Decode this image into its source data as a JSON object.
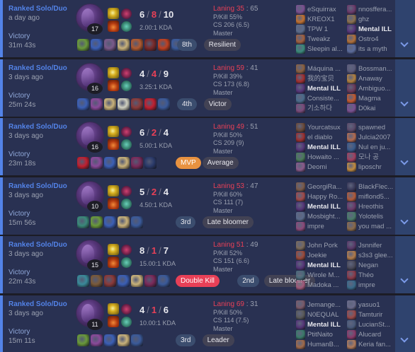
{
  "colors": {
    "background": "#1c1c25",
    "card": "#293152",
    "win_accent": "#5383e8",
    "expand_bg": "#2f436e",
    "death_red": "#e84057",
    "mvp_orange": "#e89240",
    "tag_gray": "#424254"
  },
  "matches": [
    {
      "queue": "Ranked Solo/Duo",
      "ago": "a day ago",
      "result": "Victory",
      "duration": "31m 43s",
      "champ_level": "17",
      "kills": "6",
      "deaths": "8",
      "assists": "10",
      "kda_ratio": "2.00:1 KDA",
      "laning_label": "Laning",
      "laning_win": "35",
      "laning_loss": "65",
      "pkill": "P/Kill 55%",
      "cs": "CS 206 (6.5)",
      "rank": "Master",
      "item_colors": [
        "#6a9a3a",
        "#3b5fb5",
        "#7a5a8a",
        "#c9b27a",
        "#b05a30",
        "#7a2a2a",
        "#c04020",
        "#3a5a9a"
      ],
      "tags": [
        {
          "label": "8th",
          "style": "pos"
        },
        {
          "label": "Resilient",
          "style": "norm"
        }
      ],
      "blue_team": [
        {
          "name": "eSquirrax",
          "color": "#7a5090"
        },
        {
          "name": "KREOX1",
          "color": "#c07030"
        },
        {
          "name": "TPW 1",
          "color": "#5a6a8a"
        },
        {
          "name": "Tweakz",
          "color": "#a06040"
        },
        {
          "name": "Sleepin al...",
          "color": "#3a8a7a"
        }
      ],
      "red_team": [
        {
          "name": "nnosffera...",
          "color": "#6a3a6a"
        },
        {
          "name": "ghz",
          "color": "#8a7050"
        },
        {
          "name": "Mental ILL",
          "color": "#553578",
          "me": true
        },
        {
          "name": "Ostro4",
          "color": "#b0703a"
        },
        {
          "name": "its a myth",
          "color": "#5a6a9a"
        }
      ]
    },
    {
      "queue": "Ranked Solo/Duo",
      "ago": "3 days ago",
      "result": "Victory",
      "duration": "25m 24s",
      "champ_level": "16",
      "kills": "4",
      "deaths": "4",
      "assists": "9",
      "kda_ratio": "3.25:1 KDA",
      "laning_label": "Laning",
      "laning_win": "59",
      "laning_loss": "41",
      "pkill": "P/Kill 39%",
      "cs": "CS 173 (6.8)",
      "rank": "Master",
      "item_colors": [
        "#3b5fb5",
        "#8a4a9a",
        "#c9b27a",
        "#d0d0c0",
        "#8a3a3a",
        "#c02030",
        "#3a5a9a"
      ],
      "tags": [
        {
          "label": "4th",
          "style": "pos"
        },
        {
          "label": "Victor",
          "style": "norm"
        }
      ],
      "blue_team": [
        {
          "name": "Máquina ...",
          "color": "#8a6040"
        },
        {
          "name": "我的宝贝",
          "color": "#a03030"
        },
        {
          "name": "Mental ILL",
          "color": "#553578",
          "me": true
        },
        {
          "name": "Consiste...",
          "color": "#4a6a8a"
        },
        {
          "name": "기소하다",
          "color": "#7a4a7a"
        }
      ],
      "red_team": [
        {
          "name": "Bossman...",
          "color": "#5a5a7a"
        },
        {
          "name": "Anaway",
          "color": "#b08040"
        },
        {
          "name": "Ambiguo...",
          "color": "#6a3a5a"
        },
        {
          "name": "Magma",
          "color": "#c05a30"
        },
        {
          "name": "D0kai",
          "color": "#7a5090"
        }
      ]
    },
    {
      "queue": "Ranked Solo/Duo",
      "ago": "3 days ago",
      "result": "Victory",
      "duration": "23m 18s",
      "champ_level": "16",
      "kills": "6",
      "deaths": "2",
      "assists": "4",
      "kda_ratio": "5.00:1 KDA",
      "laning_label": "Laning",
      "laning_win": "49",
      "laning_loss": "51",
      "pkill": "P/Kill 50%",
      "cs": "CS 209 (9)",
      "rank": "Master",
      "item_colors": [
        "#c02030",
        "#8a4a9a",
        "#3b5fb5",
        "#c9b27a",
        "#7a2a5a",
        "#2a3a6a"
      ],
      "tags": [
        {
          "label": "MVP",
          "style": "mvp"
        },
        {
          "label": "Average",
          "style": "norm"
        }
      ],
      "blue_team": [
        {
          "name": "Yourcatsux",
          "color": "#6a4a3a"
        },
        {
          "name": "el diablo",
          "color": "#9a3030"
        },
        {
          "name": "Mental ILL",
          "color": "#553578",
          "me": true
        },
        {
          "name": "Howaito ...",
          "color": "#4a7a5a"
        },
        {
          "name": "Deomi",
          "color": "#8a5a8a"
        }
      ],
      "red_team": [
        {
          "name": "spawned",
          "color": "#5a4a6a"
        },
        {
          "name": "Julcia2007",
          "color": "#b06a50"
        },
        {
          "name": "Nul en ju...",
          "color": "#3a5a8a"
        },
        {
          "name": "모나 공",
          "color": "#a04060"
        },
        {
          "name": "liposchr",
          "color": "#c08a40"
        }
      ]
    },
    {
      "queue": "Ranked Solo/Duo",
      "ago": "3 days ago",
      "result": "Victory",
      "duration": "15m 56s",
      "champ_level": "10",
      "kills": "5",
      "deaths": "2",
      "assists": "4",
      "kda_ratio": "4.50:1 KDA",
      "laning_label": "Laning",
      "laning_win": "53",
      "laning_loss": "47",
      "pkill": "P/Kill 60%",
      "cs": "CS 111 (7)",
      "rank": "Master",
      "item_colors": [
        "#3a8a7a",
        "#6a9a3a",
        "#3b5fb5",
        "#c9b27a",
        "#3a5a9a"
      ],
      "tags": [
        {
          "label": "3rd",
          "style": "pos"
        },
        {
          "label": "Late bloomer",
          "style": "norm"
        }
      ],
      "blue_team": [
        {
          "name": "GeorgiRa...",
          "color": "#7a5a4a"
        },
        {
          "name": "Happy Ro...",
          "color": "#a04a4a"
        },
        {
          "name": "Mental ILL",
          "color": "#553578",
          "me": true
        },
        {
          "name": "Mosbight...",
          "color": "#5a6a8a"
        },
        {
          "name": "impre",
          "color": "#8a4a7a"
        }
      ],
      "red_team": [
        {
          "name": "BlackFlec...",
          "color": "#3a3a5a"
        },
        {
          "name": "miflond5...",
          "color": "#b05a3a"
        },
        {
          "name": "Hreothis",
          "color": "#6a3a6a"
        },
        {
          "name": "Yolotelis",
          "color": "#4a7a6a"
        },
        {
          "name": "you mad ...",
          "color": "#8a6a4a"
        }
      ]
    },
    {
      "queue": "Ranked Solo/Duo",
      "ago": "3 days ago",
      "result": "Victory",
      "duration": "22m 43s",
      "champ_level": "15",
      "kills": "8",
      "deaths": "1",
      "assists": "7",
      "kda_ratio": "15.00:1 KDA",
      "laning_label": "Laning",
      "laning_win": "51",
      "laning_loss": "49",
      "pkill": "P/Kill 52%",
      "cs": "CS 151 (6.6)",
      "rank": "Master",
      "item_colors": [
        "#3a8a9a",
        "#7a5a3a",
        "#8a3a3a",
        "#3b5fb5",
        "#c9b27a",
        "#7a2a5a",
        "#3a5a9a"
      ],
      "tags": [
        {
          "label": "Double Kill",
          "style": "red"
        },
        {
          "label": "2nd",
          "style": "pos"
        },
        {
          "label": "Late bloomer",
          "style": "norm"
        }
      ],
      "blue_team": [
        {
          "name": "John Pork",
          "color": "#7a6a5a"
        },
        {
          "name": "Joekie",
          "color": "#9a4a3a"
        },
        {
          "name": "Mental ILL",
          "color": "#553578",
          "me": true
        },
        {
          "name": "Wirole M...",
          "color": "#4a6a7a"
        },
        {
          "name": "Madoka ...",
          "color": "#a05a7a"
        }
      ],
      "red_team": [
        {
          "name": "Jsnnifer",
          "color": "#5a3a6a"
        },
        {
          "name": "s3s3 glee...",
          "color": "#b07a4a"
        },
        {
          "name": "Negan",
          "color": "#4a4a5a"
        },
        {
          "name": "Théo",
          "color": "#8a3a4a"
        },
        {
          "name": "impre",
          "color": "#3a6a8a"
        }
      ]
    },
    {
      "queue": "Ranked Solo/Duo",
      "ago": "3 days ago",
      "result": "Victory",
      "duration": "15m 11s",
      "champ_level": "11",
      "kills": "4",
      "deaths": "1",
      "assists": "6",
      "kda_ratio": "10.00:1 KDA",
      "laning_label": "Laning",
      "laning_win": "69",
      "laning_loss": "31",
      "pkill": "P/Kill 50%",
      "cs": "CS 114 (7.5)",
      "rank": "Master",
      "item_colors": [
        "#6a9a3a",
        "#8a4a9a",
        "#3b5fb5",
        "#c9b27a",
        "#3a5a9a"
      ],
      "tags": [
        {
          "label": "3rd",
          "style": "pos"
        },
        {
          "label": "Leader",
          "style": "norm"
        }
      ],
      "blue_team": [
        {
          "name": "Jemange...",
          "color": "#7a5a6a"
        },
        {
          "name": "N0EQUAL",
          "color": "#5a5a5a"
        },
        {
          "name": "Mental ILL",
          "color": "#553578",
          "me": true
        },
        {
          "name": "PtitNaito",
          "color": "#3a7a6a"
        },
        {
          "name": "HumanB...",
          "color": "#a06a4a"
        }
      ],
      "red_team": [
        {
          "name": "yasuo1",
          "color": "#6a6a8a"
        },
        {
          "name": "Tamturir",
          "color": "#9a4a4a"
        },
        {
          "name": "LucianSt...",
          "color": "#4a5a7a"
        },
        {
          "name": "Alucard",
          "color": "#8a3a6a"
        },
        {
          "name": "Keria fan...",
          "color": "#b07a5a"
        }
      ]
    }
  ]
}
